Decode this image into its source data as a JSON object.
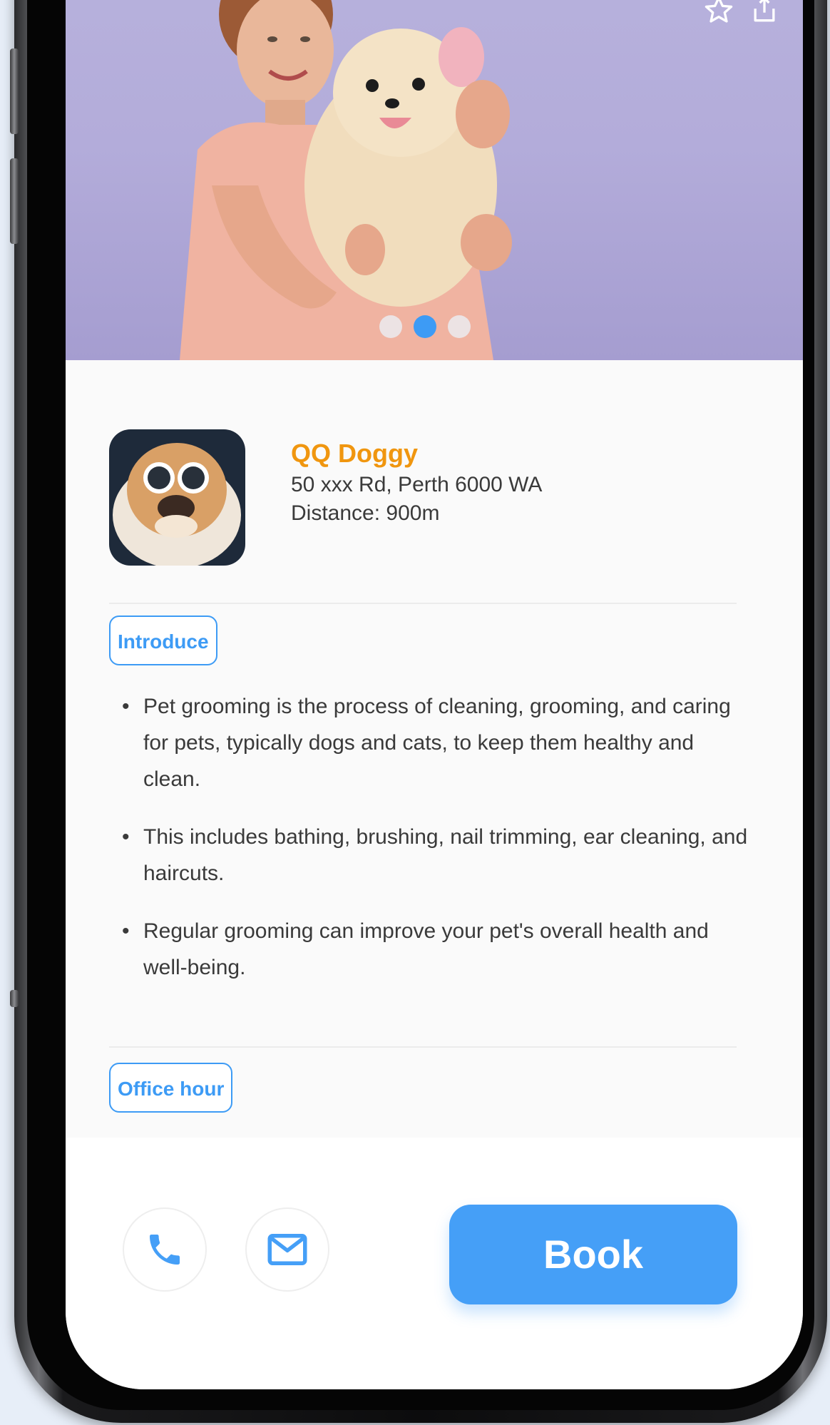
{
  "hero": {
    "icons": {
      "favorite": "star-outline-icon",
      "share": "share-icon"
    },
    "carousel": {
      "total": 3,
      "active_index": 1
    }
  },
  "shop": {
    "name": "QQ Doggy",
    "address": "50 xxx Rd, Perth 6000 WA",
    "distance": "Distance: 900m"
  },
  "sections": {
    "introduce": {
      "label": "Introduce",
      "bullets": [
        "Pet grooming is the process of cleaning, grooming, and caring for pets, typically dogs and cats, to keep them healthy and clean.",
        "This includes bathing, brushing, nail trimming, ear cleaning, and haircuts.",
        "Regular grooming can improve your pet's overall health and well-being."
      ]
    },
    "office_hour": {
      "label": "Office hour"
    }
  },
  "actions": {
    "call_icon": "phone-icon",
    "mail_icon": "mail-icon",
    "book_label": "Book"
  },
  "colors": {
    "accent_blue": "#3d9bf5",
    "brand_orange": "#f0960f",
    "hero_background": "#b3acda"
  }
}
